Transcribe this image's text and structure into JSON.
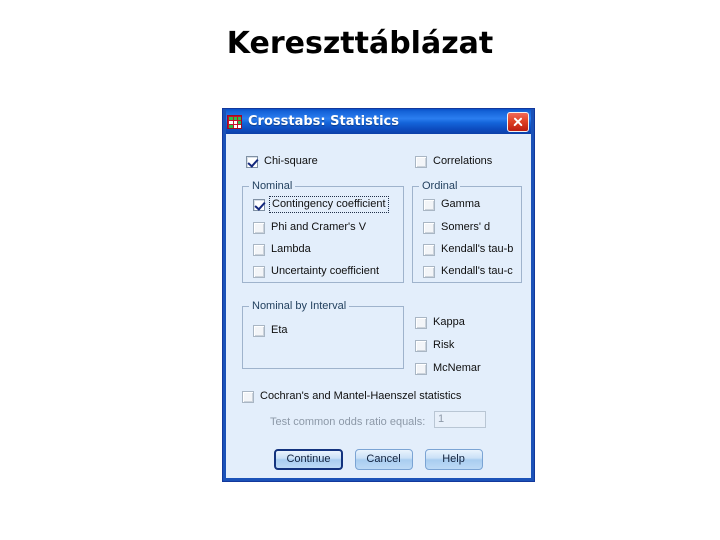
{
  "slide": {
    "title": "Kereszttáblázat"
  },
  "dialog": {
    "titlebar": {
      "title": "Crosstabs: Statistics",
      "icon": "crosstabs-table-icon",
      "close_label": "Close"
    },
    "top_checkboxes": [
      {
        "label": "Chi-square",
        "checked": true,
        "enabled": true
      },
      {
        "label": "Correlations",
        "checked": false,
        "enabled": true
      }
    ],
    "nominal_group": {
      "title": "Nominal",
      "items": [
        {
          "label": "Contingency coefficient",
          "checked": true,
          "focused": true
        },
        {
          "label": "Phi and Cramer's V",
          "checked": false,
          "focused": false
        },
        {
          "label": "Lambda",
          "checked": false,
          "focused": false
        },
        {
          "label": "Uncertainty coefficient",
          "checked": false,
          "focused": false
        }
      ]
    },
    "ordinal_group": {
      "title": "Ordinal",
      "items": [
        {
          "label": "Gamma",
          "checked": false
        },
        {
          "label": "Somers' d",
          "checked": false
        },
        {
          "label": "Kendall's tau-b",
          "checked": false
        },
        {
          "label": "Kendall's tau-c",
          "checked": false
        }
      ]
    },
    "nominal_by_interval_group": {
      "title": "Nominal by Interval",
      "items": [
        {
          "label": "Eta",
          "checked": false
        }
      ]
    },
    "right_checkboxes": [
      {
        "label": "Kappa",
        "checked": false
      },
      {
        "label": "Risk",
        "checked": false
      },
      {
        "label": "McNemar",
        "checked": false
      }
    ],
    "cochran": {
      "label": "Cochran's and Mantel-Haenszel statistics",
      "checked": false,
      "odds_label": "Test common odds ratio equals:",
      "odds_value": "1"
    },
    "buttons": [
      {
        "label": "Continue",
        "default": true
      },
      {
        "label": "Cancel",
        "default": false
      },
      {
        "label": "Help",
        "default": false
      }
    ]
  },
  "colors": {
    "dialog_background": "#e3eefb",
    "titlebar_blue": "#1563d8",
    "dialog_border": "#1b52b8",
    "close_red": "#e04226",
    "check_mark": "#14287d",
    "group_border": "#9fb3cc",
    "disabled_text": "#8d99a8"
  }
}
